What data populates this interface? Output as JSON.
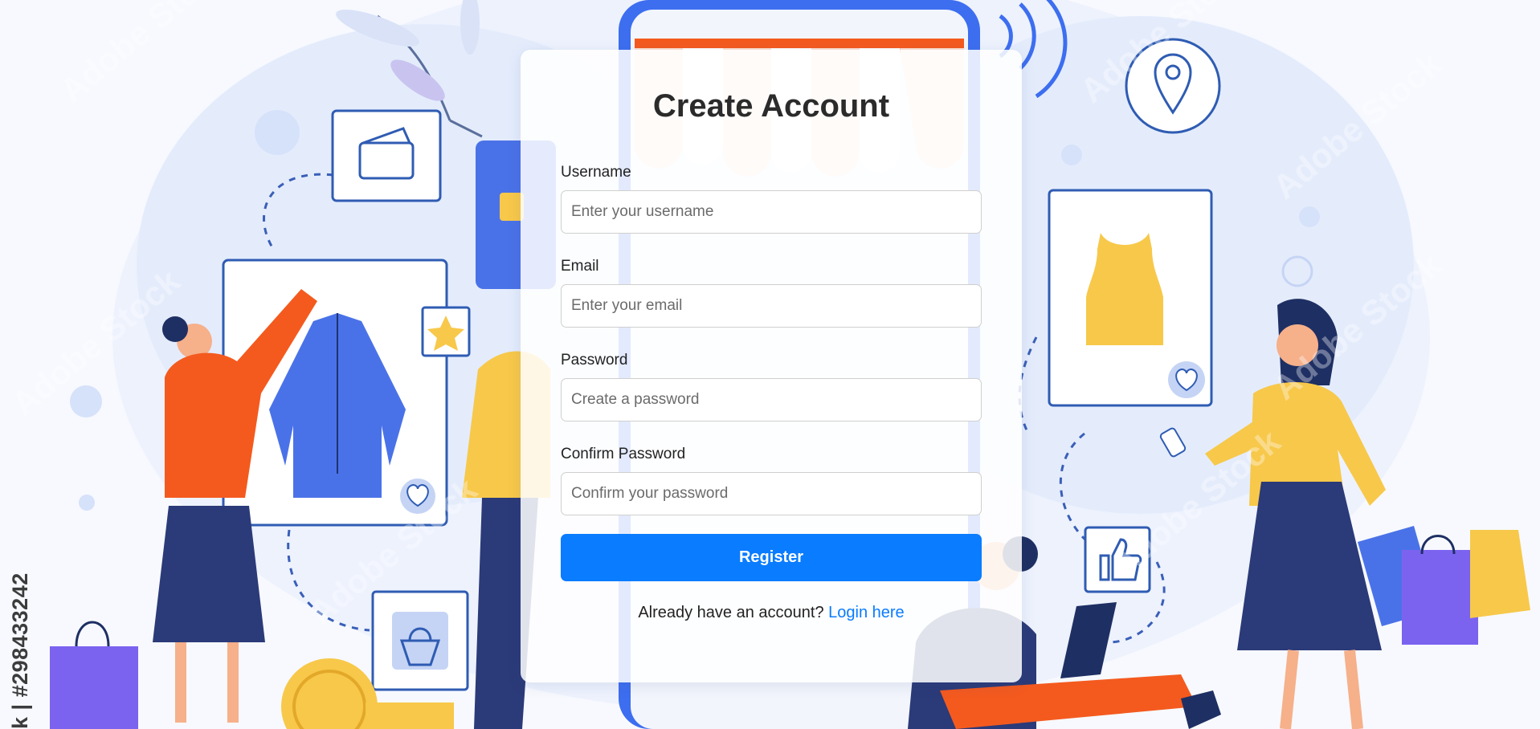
{
  "background": {
    "watermark_text": "Adobe Stock",
    "stock_id": "k | #298433242"
  },
  "form": {
    "title": "Create Account",
    "username": {
      "label": "Username",
      "placeholder": "Enter your username"
    },
    "email": {
      "label": "Email",
      "placeholder": "Enter your email"
    },
    "password": {
      "label": "Password",
      "placeholder": "Create a password"
    },
    "confirm_password": {
      "label": "Confirm Password",
      "placeholder": "Confirm your password"
    },
    "register_label": "Register",
    "login_prompt": "Already have an account?",
    "login_link": "Login here"
  },
  "colors": {
    "accent": "#0a7cff",
    "illustration_blue": "#4a72e8",
    "illustration_orange": "#f45a1e",
    "illustration_yellow": "#f7c84a",
    "illustration_navy": "#2b3a78"
  }
}
